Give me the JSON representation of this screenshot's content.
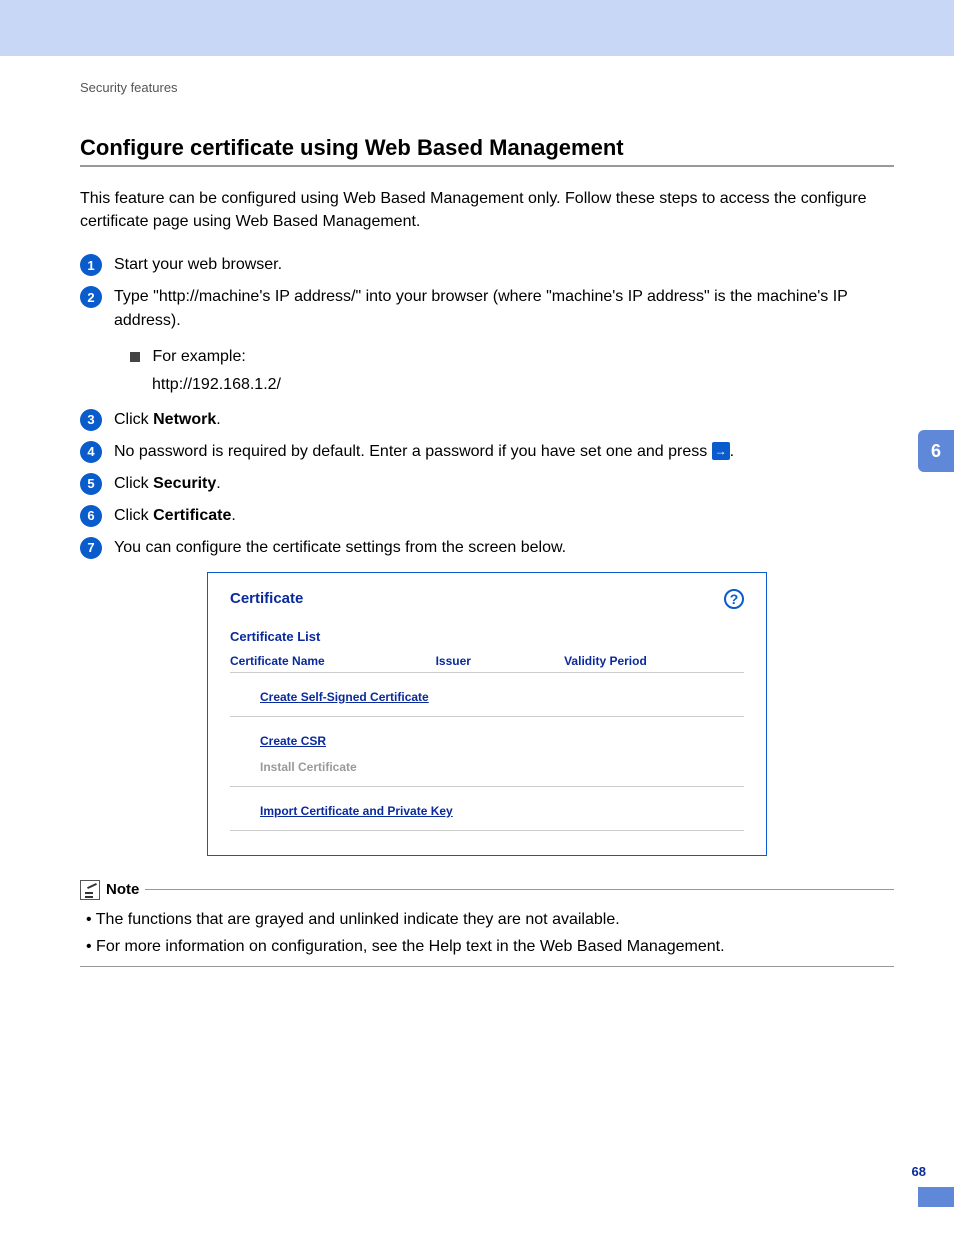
{
  "breadcrumb": "Security features",
  "title": "Configure certificate using Web Based Management",
  "intro": "This feature can be configured using Web Based Management only. Follow these steps to access the configure certificate page using Web Based Management.",
  "steps": {
    "s1": "Start your web browser.",
    "s2": "Type \"http://machine's IP address/\" into your browser (where \"machine's IP address\" is the machine's IP address).",
    "s2_example_label": "For example:",
    "s2_example_url": "http://192.168.1.2/",
    "s3_pre": "Click ",
    "s3_bold": "Network",
    "s3_post": ".",
    "s4_pre": "No password is required by default. Enter a password if you have set one and press ",
    "s4_post": ".",
    "s5_pre": "Click ",
    "s5_bold": "Security",
    "s5_post": ".",
    "s6_pre": "Click ",
    "s6_bold": "Certificate",
    "s6_post": ".",
    "s7": "You can configure the certificate settings from the screen below."
  },
  "cert": {
    "title": "Certificate",
    "list_title": "Certificate List",
    "cols": {
      "c1": "Certificate Name",
      "c2": "Issuer",
      "c3": "Validity Period"
    },
    "link_selfsigned": "Create Self-Signed Certificate",
    "link_csr": "Create CSR",
    "disabled_install": "Install Certificate",
    "link_import": "Import Certificate and Private Key"
  },
  "note": {
    "label": "Note",
    "b1": "The functions that are grayed and unlinked indicate they are not available.",
    "b2": "For more information on configuration, see the Help text in the Web Based Management."
  },
  "chapter_tab": "6",
  "page_number": "68"
}
